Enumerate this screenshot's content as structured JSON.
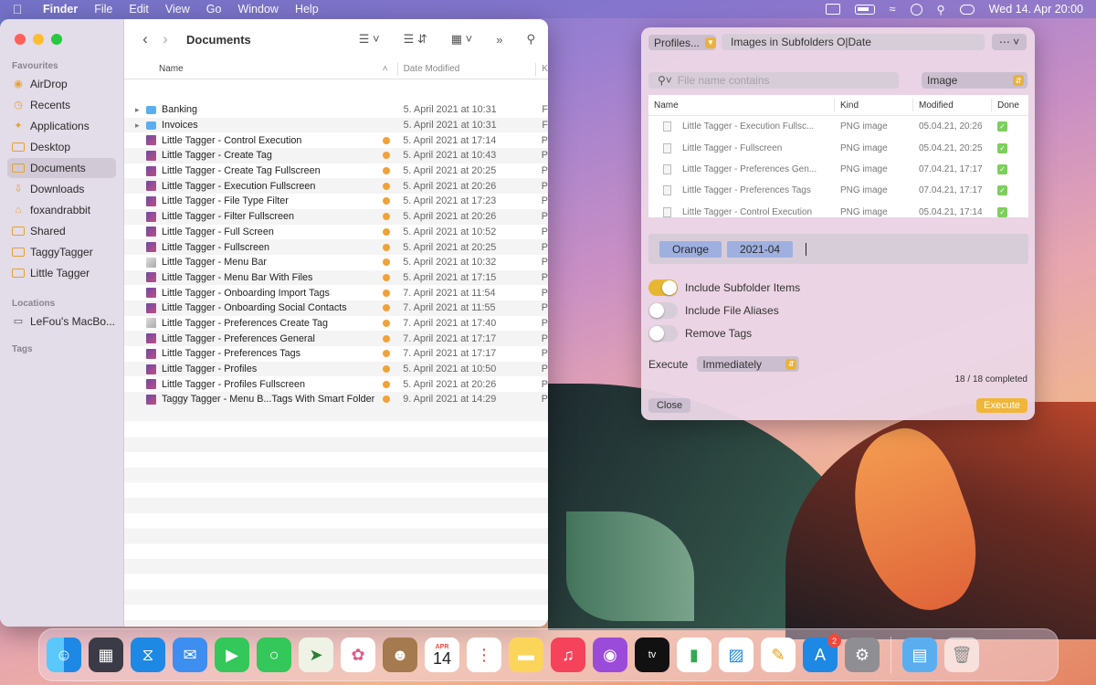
{
  "menubar": {
    "app": "Finder",
    "menus": [
      "File",
      "Edit",
      "View",
      "Go",
      "Window",
      "Help"
    ],
    "clock": "Wed 14. Apr  20:00"
  },
  "finder": {
    "title": "Documents",
    "sidebar": {
      "favourites_label": "Favourites",
      "favourites": [
        "AirDrop",
        "Recents",
        "Applications",
        "Desktop",
        "Documents",
        "Downloads",
        "foxandrabbit",
        "Shared",
        "TaggyTagger",
        "Little Tagger"
      ],
      "locations_label": "Locations",
      "locations": [
        "LeFou's MacBo..."
      ],
      "tags_label": "Tags"
    },
    "columns": {
      "name": "Name",
      "date": "Date Modified",
      "kind": "K"
    },
    "files": [
      {
        "name": "Banking",
        "date": "5. April 2021 at 10:31",
        "kind": "F",
        "folder": true,
        "tag": false
      },
      {
        "name": "Invoices",
        "date": "5. April 2021 at 10:31",
        "kind": "F",
        "folder": true,
        "tag": false
      },
      {
        "name": "Little Tagger - Control Execution",
        "date": "5. April 2021 at 17:14",
        "kind": "P",
        "tag": true
      },
      {
        "name": "Little Tagger - Create Tag",
        "date": "5. April 2021 at 10:43",
        "kind": "P",
        "tag": true
      },
      {
        "name": "Little Tagger - Create Tag Fullscreen",
        "date": "5. April 2021 at 20:25",
        "kind": "P",
        "tag": true
      },
      {
        "name": "Little Tagger - Execution Fullscreen",
        "date": "5. April 2021 at 20:26",
        "kind": "P",
        "tag": true
      },
      {
        "name": "Little Tagger - File Type Filter",
        "date": "5. April 2021 at 17:23",
        "kind": "P",
        "tag": true
      },
      {
        "name": "Little Tagger - Filter Fullscreen",
        "date": "5. April 2021 at 20:26",
        "kind": "P",
        "tag": true
      },
      {
        "name": "Little Tagger - Full Screen",
        "date": "5. April 2021 at 10:52",
        "kind": "P",
        "tag": true
      },
      {
        "name": "Little Tagger - Fullscreen",
        "date": "5. April 2021 at 20:25",
        "kind": "P",
        "tag": true
      },
      {
        "name": "Little Tagger - Menu Bar",
        "date": "5. April 2021 at 10:32",
        "kind": "P",
        "tag": true
      },
      {
        "name": "Little Tagger - Menu Bar With Files",
        "date": "5. April 2021 at 17:15",
        "kind": "P",
        "tag": true
      },
      {
        "name": "Little Tagger - Onboarding Import Tags",
        "date": "7. April 2021 at 11:54",
        "kind": "P",
        "tag": true
      },
      {
        "name": "Little Tagger - Onboarding Social Contacts",
        "date": "7. April 2021 at 11:55",
        "kind": "P",
        "tag": true
      },
      {
        "name": "Little Tagger - Preferences Create Tag",
        "date": "7. April 2021 at 17:40",
        "kind": "P",
        "tag": true
      },
      {
        "name": "Little Tagger - Preferences General",
        "date": "7. April 2021 at 17:17",
        "kind": "P",
        "tag": true
      },
      {
        "name": "Little Tagger - Preferences Tags",
        "date": "7. April 2021 at 17:17",
        "kind": "P",
        "tag": true
      },
      {
        "name": "Little Tagger - Profiles",
        "date": "5. April 2021 at 10:50",
        "kind": "P",
        "tag": true
      },
      {
        "name": "Little Tagger - Profiles Fullscreen",
        "date": "5. April 2021 at 20:26",
        "kind": "P",
        "tag": true
      },
      {
        "name": "Taggy Tagger - Menu B...Tags With Smart Folder",
        "date": "9. April 2021 at 14:29",
        "kind": "P",
        "tag": true
      }
    ]
  },
  "panel": {
    "profiles_label": "Profiles...",
    "profile_name": "Images in Subfolders O|Date",
    "search_placeholder": "File name contains",
    "type_filter": "Image",
    "columns": {
      "name": "Name",
      "kind": "Kind",
      "modified": "Modified",
      "done": "Done"
    },
    "rows": [
      {
        "name": "Little Tagger - Execution Fullsc...",
        "kind": "PNG image",
        "modified": "05.04.21, 20:26"
      },
      {
        "name": "Little Tagger - Fullscreen",
        "kind": "PNG image",
        "modified": "05.04.21, 20:25"
      },
      {
        "name": "Little Tagger - Preferences Gen...",
        "kind": "PNG image",
        "modified": "07.04.21, 17:17"
      },
      {
        "name": "Little Tagger - Preferences Tags",
        "kind": "PNG image",
        "modified": "07.04.21, 17:17"
      },
      {
        "name": "Little Tagger - Control Execution",
        "kind": "PNG image",
        "modified": "05.04.21, 17:14"
      }
    ],
    "tags": [
      "Orange",
      "2021-04"
    ],
    "options": [
      {
        "label": "Include Subfolder Items",
        "on": true
      },
      {
        "label": "Include File Aliases",
        "on": false
      },
      {
        "label": "Remove Tags",
        "on": false
      }
    ],
    "execute_label": "Execute",
    "execute_mode": "Immediately",
    "progress": "18 / 18 completed",
    "close_button": "Close",
    "execute_button": "Execute"
  },
  "dock": {
    "calendar_month": "APR",
    "calendar_day": "14",
    "appstore_badge": "2"
  }
}
